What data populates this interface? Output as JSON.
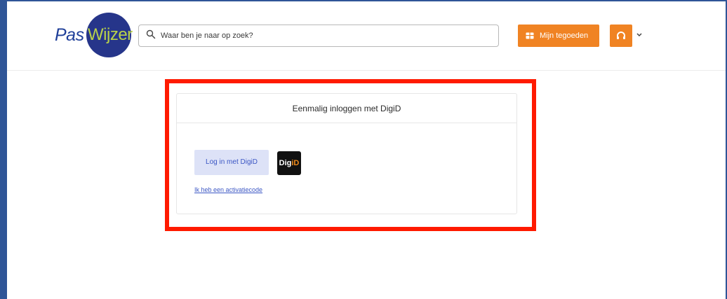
{
  "logo": {
    "part1": "Pas",
    "part2": "Wijzer"
  },
  "search": {
    "placeholder": "Waar ben je naar op zoek?",
    "icon": "search-icon"
  },
  "header": {
    "credits_label": "Mijn tegoeden",
    "credits_icon": "wallet-icon",
    "user_icon": "headphones-icon",
    "menu_icon": "chevron-down-icon"
  },
  "login_card": {
    "title": "Eenmalig inloggen met DigiD",
    "login_button": "Log in met DigiD",
    "digid_logo_part1": "Dig",
    "digid_logo_part2": "iD",
    "activation_link": "Ik heb een activatiecode"
  },
  "colors": {
    "brand_orange": "#f08323",
    "brand_blue": "#26358a",
    "brand_green": "#b9d24a",
    "highlight_red": "#ff1a00",
    "link_blue": "#3b56c4",
    "button_bg": "#dde2f7"
  }
}
